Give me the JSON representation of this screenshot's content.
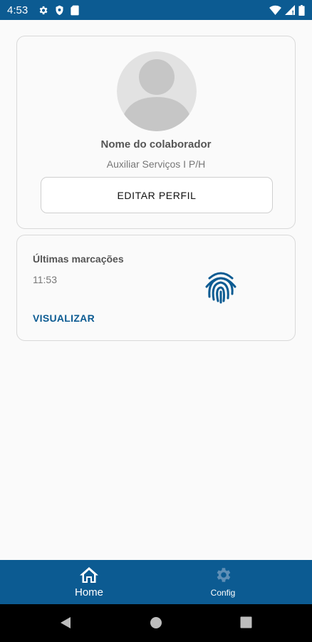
{
  "status_bar": {
    "time": "4:53",
    "left_icons": [
      "gear-icon",
      "shield-icon",
      "sd-card-icon"
    ],
    "right_icons": [
      "wifi-icon",
      "signal-icon",
      "battery-icon"
    ]
  },
  "profile": {
    "name": "Nome do colaborador",
    "role": "Auxiliar Serviços I P/H",
    "edit_label": "EDITAR PERFIL",
    "avatar_icon": "person-placeholder-icon"
  },
  "marks": {
    "title": "Últimas marcações",
    "time": "11:53",
    "view_label": "VISUALIZAR",
    "icon": "fingerprint-icon"
  },
  "bottom_nav": {
    "items": [
      {
        "label": "Home",
        "icon": "home-icon",
        "active": true
      },
      {
        "label": "Config",
        "icon": "gear-icon",
        "active": false
      }
    ]
  },
  "system_nav": {
    "buttons": [
      "back-icon",
      "home-circle-icon",
      "recents-icon"
    ]
  },
  "colors": {
    "primary": "#0c5b92",
    "background": "#fafafa",
    "inactive_icon": "#5f8fb6"
  }
}
